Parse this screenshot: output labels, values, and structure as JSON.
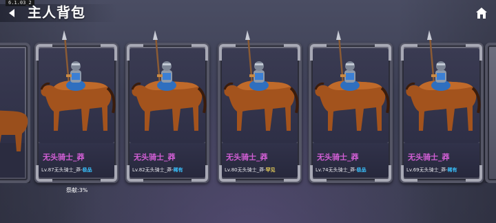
{
  "version": "6.1.03_2",
  "header": {
    "title": "主人背包"
  },
  "cards": [
    {
      "name": "无头骑士_莽",
      "level": "Lv.87无头骑士_莽-",
      "rarity": "极品",
      "rarity_color": "#39c3ff"
    },
    {
      "name": "无头骑士_莽",
      "level": "Lv.82无头骑士_莽-",
      "rarity": "稀有",
      "rarity_color": "#39c3ff"
    },
    {
      "name": "无头骑士_莽",
      "level": "Lv.80无头骑士_莽-",
      "rarity": "罕见",
      "rarity_color": "#f2d85a"
    },
    {
      "name": "无头骑士_莽",
      "level": "Lv.74无头骑士_莽-",
      "rarity": "极品",
      "rarity_color": "#39c3ff"
    },
    {
      "name": "无头骑士_莽",
      "level": "Lv.69无头骑士_莽-",
      "rarity": "稀有",
      "rarity_color": "#39c3ff"
    }
  ],
  "contribution": "祭献:3%",
  "icons": {
    "back": "back-arrow-icon",
    "home": "home-icon"
  },
  "colors": {
    "name": "#d35fd6",
    "background": "#44465b"
  }
}
